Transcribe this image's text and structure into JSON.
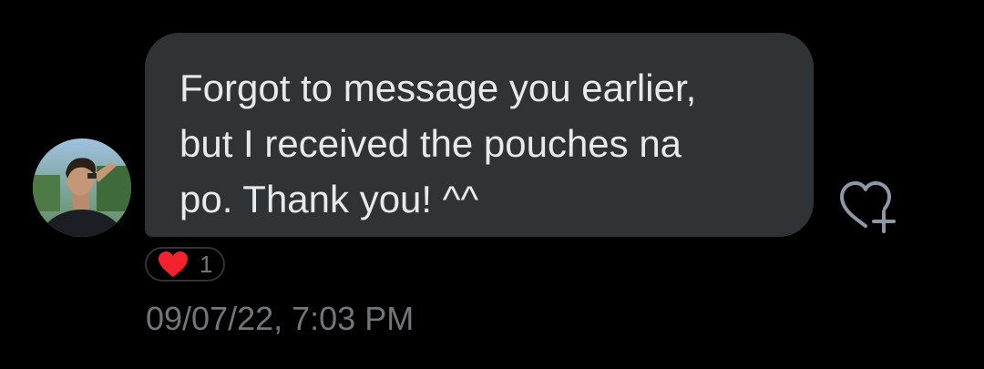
{
  "message": {
    "text": "Forgot to message you earlier,\nbut I received the pouches na\npo. Thank you! ^^",
    "timestamp": "09/07/22, 7:03 PM",
    "reactions": [
      {
        "icon": "red-heart-icon",
        "count": "1"
      }
    ]
  },
  "actions": {
    "react_icon": "heart-plus-icon"
  },
  "colors": {
    "background": "#000000",
    "bubble": "#2f3336",
    "text": "#e7e9ea",
    "muted": "#71767b",
    "heart": "#f4212e"
  }
}
